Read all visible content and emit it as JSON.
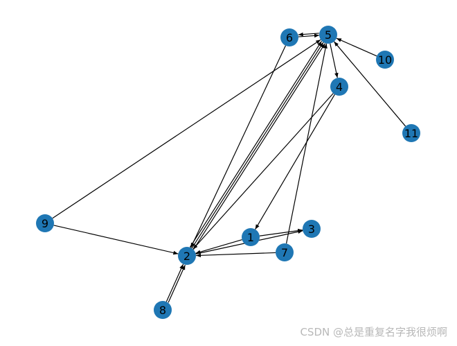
{
  "graph": {
    "node_color": "#1f77b4",
    "edge_color": "#000000",
    "label_color": "#000000",
    "nodes": [
      "1",
      "2",
      "3",
      "4",
      "5",
      "6",
      "7",
      "8",
      "9",
      "10",
      "11"
    ],
    "edges": [
      [
        "6",
        "5"
      ],
      [
        "5",
        "6"
      ],
      [
        "10",
        "5"
      ],
      [
        "11",
        "5"
      ],
      [
        "5",
        "4"
      ],
      [
        "4",
        "1"
      ],
      [
        "4",
        "2"
      ],
      [
        "6",
        "2"
      ],
      [
        "2",
        "5"
      ],
      [
        "2",
        "5"
      ],
      [
        "2",
        "5"
      ],
      [
        "7",
        "5"
      ],
      [
        "9",
        "5"
      ],
      [
        "9",
        "2"
      ],
      [
        "1",
        "3"
      ],
      [
        "2",
        "3"
      ],
      [
        "1",
        "2"
      ],
      [
        "7",
        "2"
      ],
      [
        "8",
        "2"
      ],
      [
        "8",
        "2"
      ]
    ]
  },
  "watermark": "CSDN @总是重复名字我很烦啊"
}
